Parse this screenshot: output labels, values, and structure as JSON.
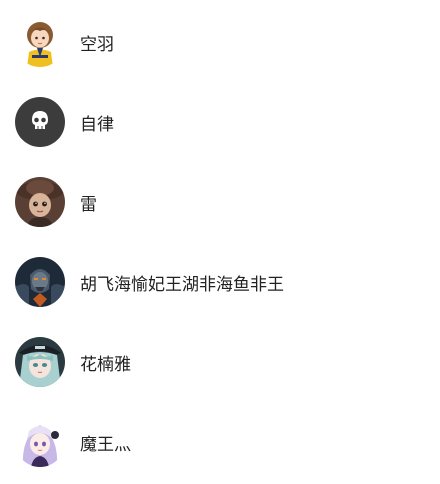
{
  "friends": [
    {
      "name": "空羽",
      "avatar": "avatar-cartoon-girl-icon"
    },
    {
      "name": "自律",
      "avatar": "avatar-skull-icon"
    },
    {
      "name": "雷",
      "avatar": "avatar-boy-hat-icon"
    },
    {
      "name": "胡飞海愉妃王湖非海鱼非王",
      "avatar": "avatar-armored-warrior-icon"
    },
    {
      "name": "花楠雅",
      "avatar": "avatar-anime-girl-icon"
    },
    {
      "name": "魔王灬",
      "avatar": "avatar-purple-hair-girl-icon"
    }
  ],
  "colors": {
    "text": "#222222",
    "background": "#ffffff",
    "skull_avatar_bg": "#3c3c3c"
  }
}
